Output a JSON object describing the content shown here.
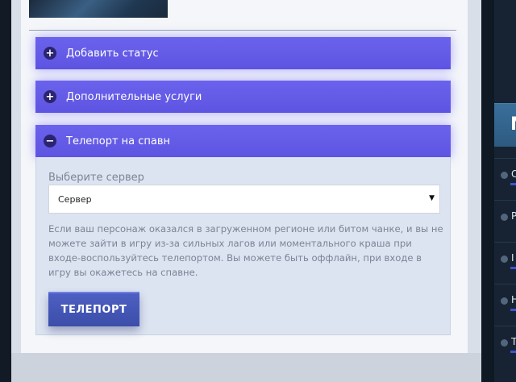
{
  "accordion": {
    "items": [
      {
        "label": "Добавить статус",
        "icon": "plus-icon",
        "symbol": "+",
        "expanded": false
      },
      {
        "label": "Дополнительные услуги",
        "icon": "plus-icon",
        "symbol": "+",
        "expanded": false
      },
      {
        "label": "Телепорт на спавн",
        "icon": "minus-icon",
        "symbol": "−",
        "expanded": true
      }
    ]
  },
  "teleport": {
    "select_label": "Выберите сервер",
    "select_value": "Сервер",
    "select_arrow": "▼",
    "description": "Если ваш персонаж оказался в загруженном регионе или битом чанке, и вы не можете зайти в игру из-за сильных лагов или моментального краша при входе-воспользуйтесь телепортом. Вы можете быть оффлайн, при входе в игру вы окажетесь на спавне.",
    "button_label": "ТЕЛЕПОРТ"
  },
  "sidebar": {
    "header_letter": "М",
    "items": [
      {
        "letter": "С",
        "has_bar": true
      },
      {
        "letter": "Р",
        "has_bar": false
      },
      {
        "letter": "I",
        "has_bar": true
      },
      {
        "letter": "Н",
        "has_bar": true
      },
      {
        "letter": "Т",
        "has_bar": true
      }
    ]
  },
  "colors": {
    "accent_purple": "#5e54e2",
    "button_blue": "#4456b6",
    "panel_bg": "#dce3f1",
    "sidebar_bg": "#172332"
  }
}
